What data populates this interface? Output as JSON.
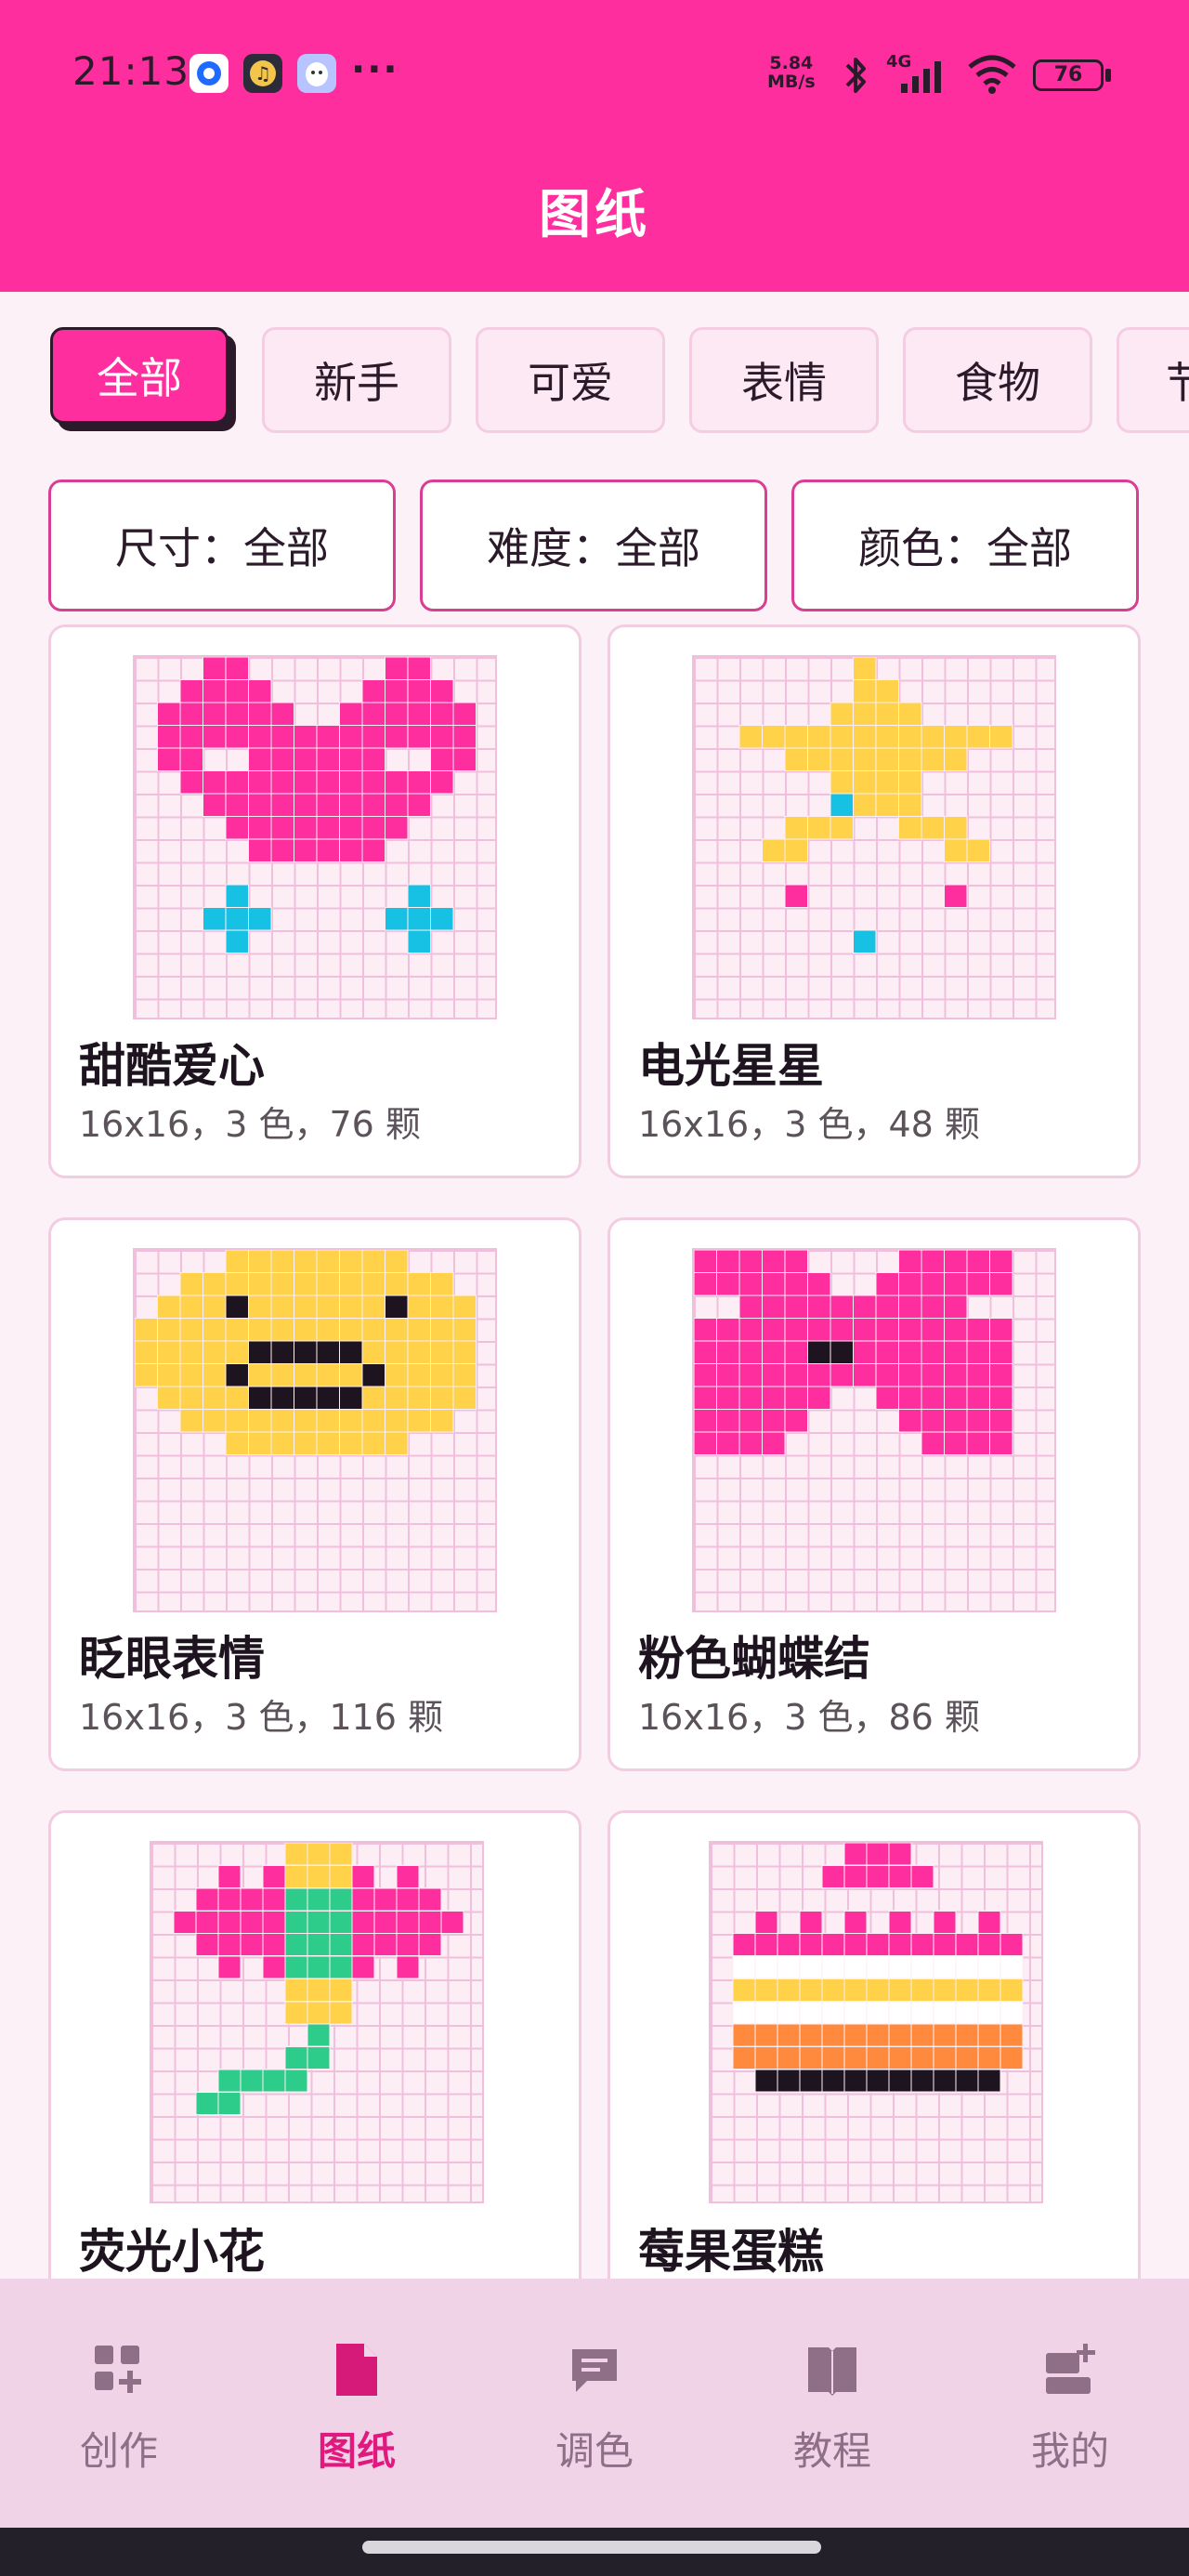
{
  "status_bar": {
    "time": "21:13",
    "more": "···",
    "net_speed_value": "5.84",
    "net_speed_unit": "MB/s",
    "network": "4G",
    "battery": "76"
  },
  "header": {
    "title": "图纸"
  },
  "tabs": [
    {
      "label": "全部",
      "active": true
    },
    {
      "label": "新手",
      "active": false
    },
    {
      "label": "可爱",
      "active": false
    },
    {
      "label": "表情",
      "active": false
    },
    {
      "label": "食物",
      "active": false
    },
    {
      "label": "节",
      "active": false
    }
  ],
  "filters": [
    {
      "label": "尺寸：全部"
    },
    {
      "label": "难度：全部"
    },
    {
      "label": "颜色：全部"
    }
  ],
  "patterns": [
    {
      "name": "甜酷爱心",
      "meta": "16x16，3 色，76 颗",
      "icon": "heart-pattern"
    },
    {
      "name": "电光星星",
      "meta": "16x16，3 色，48 颗",
      "icon": "star-pattern"
    },
    {
      "name": "眨眼表情",
      "meta": "16x16，3 色，116 颗",
      "icon": "wink-face-pattern"
    },
    {
      "name": "粉色蝴蝶结",
      "meta": "16x16，3 色，86 颗",
      "icon": "bow-pattern"
    },
    {
      "name": "荧光小花",
      "meta": "",
      "icon": "flower-pattern"
    },
    {
      "name": "莓果蛋糕",
      "meta": "",
      "icon": "cake-pattern"
    }
  ],
  "colors": {
    "pink": "#ff2e9e",
    "yellow": "#ffd24a",
    "cyan": "#16c1e3",
    "green": "#2ecc8a",
    "orange": "#ff8a3d",
    "dark": "#1e1420",
    "grid_bg": "#fdeef6"
  },
  "bottom_nav": [
    {
      "label": "创作",
      "icon": "grid-plus-icon",
      "active": false
    },
    {
      "label": "图纸",
      "icon": "document-icon",
      "active": true
    },
    {
      "label": "调色",
      "icon": "chat-bubble-icon",
      "active": false
    },
    {
      "label": "教程",
      "icon": "book-icon",
      "active": false
    },
    {
      "label": "我的",
      "icon": "profile-card-icon",
      "active": false
    }
  ]
}
